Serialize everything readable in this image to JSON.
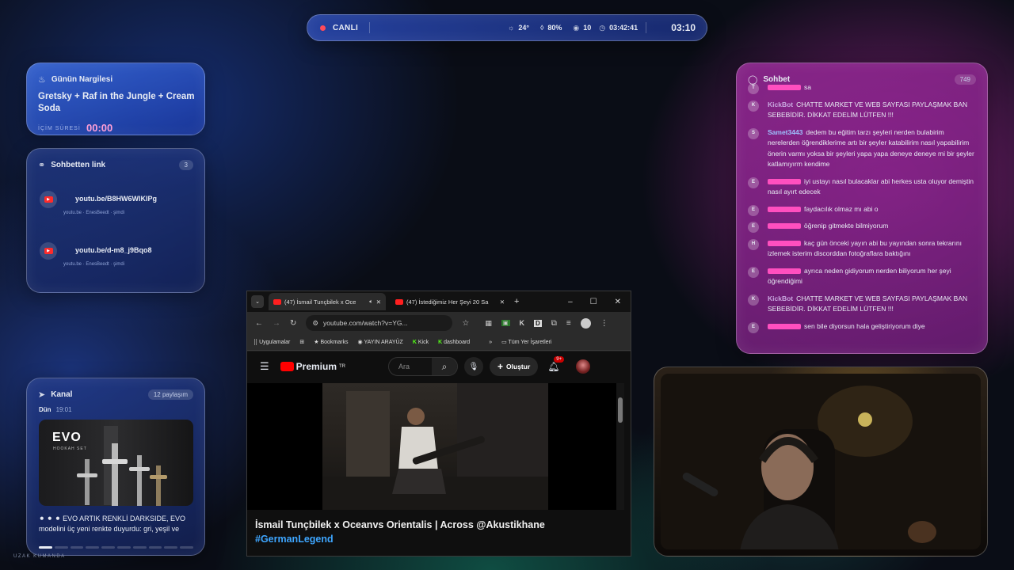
{
  "topbar": {
    "live_label": "CANLI",
    "temperature": "24°",
    "humidity": "80%",
    "viewers": "10",
    "uptime": "03:42:41",
    "clock": "03:10"
  },
  "nargile": {
    "heading": "Günün Nargilesi",
    "title": "Gretsky + Raf in the Jungle + Cream Soda",
    "duration_label": "İÇİM SÜRESİ",
    "duration": "00:00"
  },
  "links": {
    "heading": "Sohbetten link",
    "count": "3",
    "items": [
      {
        "url": "youtu.be/B8HW6WIKIPg",
        "source": "youtu.be · EnesBeedt · şimdi"
      },
      {
        "url": "youtu.be/d-m8_j9Bqo8",
        "source": "youtu.be · EnesBeedt · şimdi"
      }
    ]
  },
  "kanal": {
    "heading": "Kanal",
    "share_count": "12 paylaşım",
    "date_day": "Dün",
    "date_time": "19:01",
    "promo_brand": "EVO",
    "promo_sub": "HOOKAH SET",
    "message": "⚫ ⚫ ⚫ EVO ARTIK RENKLİ DARKSIDE, EVO modelini üç yeni renkte duyurdu: gri, yeşil ve",
    "progress_active": 1,
    "progress_total": 10
  },
  "footer_label": "UZAK KUMANDA",
  "chat": {
    "heading": "Sohbet",
    "count": "749",
    "messages": [
      {
        "initial": "T",
        "user": "",
        "text": "sa"
      },
      {
        "initial": "K",
        "user": "KickBot",
        "text": "CHATTE MARKET VE WEB SAYFASI PAYLAŞMAK BAN SEBEBİDİR. DİKKAT EDELİM LÜTFEN !!!"
      },
      {
        "initial": "S",
        "user": "Samet3443",
        "text": "dedem bu eğitim tarzı şeyleri nerden bulabirim nerelerden öğrendiklerime artı bir şeyler katabilirim nasıl yapabilirim önerin varmı yoksa bir şeyleri yapa yapa deneye deneye mi bir şeyler katlamıyırm kendime"
      },
      {
        "initial": "E",
        "user": "",
        "text": "iyi ustayı nasıl bulacaklar abi herkes usta oluyor demiştin nasıl ayırt edecek"
      },
      {
        "initial": "E",
        "user": "",
        "text": "faydacılık olmaz mı abi o"
      },
      {
        "initial": "E",
        "user": "",
        "text": "öğrenip gitmekte bilmiyorum"
      },
      {
        "initial": "H",
        "user": "",
        "text": "kaç gün önceki yayın abi bu yayından sonra tekrarını izlemek isterim discorddan fotoğraflara baktığını"
      },
      {
        "initial": "E",
        "user": "",
        "text": "ayrıca neden gidiyorum nerden biliyorum her şeyi öğrendiğimi"
      },
      {
        "initial": "K",
        "user": "KickBot",
        "text": "CHATTE MARKET VE WEB SAYFASI PAYLAŞMAK BAN SEBEBİDİR. DİKKAT EDELİM LÜTFEN !!!"
      },
      {
        "initial": "E",
        "user": "",
        "text": "sen bile diyorsun hala geliştiriyorum diye"
      }
    ]
  },
  "browser": {
    "tabs": [
      {
        "label": "(47) İsmail Tunçbilek x Oce"
      },
      {
        "label": "(47) İstediğimiz Her Şeyi 20 Sa"
      }
    ],
    "url": "youtube.com/watch?v=YG...",
    "bookmarks": [
      "Uygulamalar",
      "Bookmarks",
      "YAYIN ARAYÜZ",
      "Kick",
      "dashboard",
      "Tüm Yer İşaretleri"
    ],
    "yt_logo": "Premium",
    "yt_region": "TR",
    "search_placeholder": "Ara",
    "create_label": "Oluştur",
    "notif_count": "9+",
    "video_title": "İsmail Tunçbilek x Oceanvs Orientalis | Across @Akustikhane",
    "video_tag": "#GermanLegend"
  },
  "colors": {
    "accent_pink": "#ff9fd8",
    "live_dot": "#ff4a5a",
    "youtube_red": "#ff0000"
  }
}
